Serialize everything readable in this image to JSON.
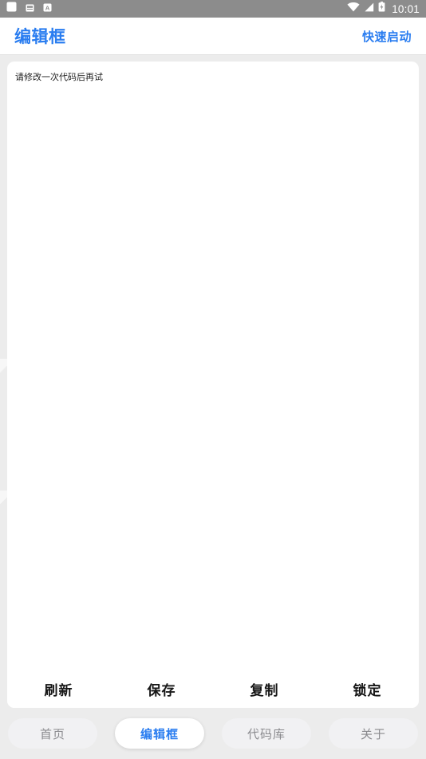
{
  "statusbar": {
    "time": "10:01",
    "left_icons": [
      {
        "name": "notification-blank-icon",
        "glyph": "▢"
      },
      {
        "name": "notification-card-icon",
        "glyph": "▤"
      },
      {
        "name": "notification-letter-a-icon",
        "glyph": "A"
      }
    ],
    "right_icons": [
      {
        "name": "wifi-icon"
      },
      {
        "name": "cellular-signal-icon"
      },
      {
        "name": "battery-charging-icon"
      }
    ]
  },
  "header": {
    "title": "编辑框",
    "quick_start_label": "快速启动"
  },
  "editor": {
    "content": "请修改一次代码后再试",
    "placeholder": "请修改一次代码后再试"
  },
  "actions": [
    {
      "label": "刷新",
      "name": "refresh-button"
    },
    {
      "label": "保存",
      "name": "save-button"
    },
    {
      "label": "复制",
      "name": "copy-button"
    },
    {
      "label": "锁定",
      "name": "lock-button"
    }
  ],
  "tabs": [
    {
      "label": "首页",
      "active": false
    },
    {
      "label": "编辑框",
      "active": true
    },
    {
      "label": "代码库",
      "active": false
    },
    {
      "label": "关于",
      "active": false
    }
  ],
  "colors": {
    "accent": "#2a7df0",
    "statusbar_bg": "#8c8c8c",
    "page_bg": "#ececec",
    "card_bg": "#ffffff",
    "tab_inactive_bg": "#f1f1f3",
    "tab_inactive_text": "#8a8a8e",
    "action_text": "#161616"
  }
}
